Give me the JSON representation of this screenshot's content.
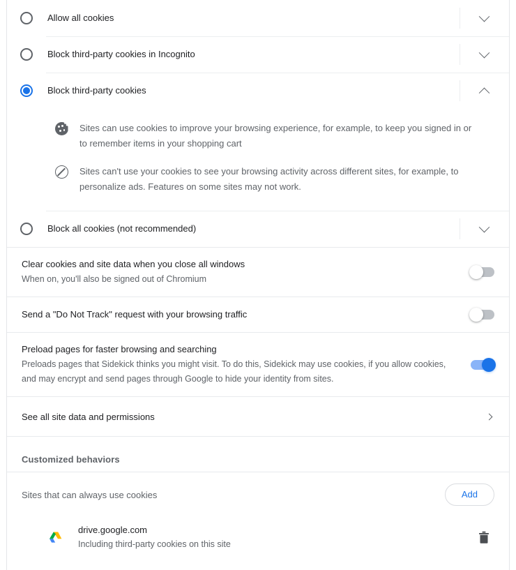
{
  "cookie_options": [
    {
      "label": "Allow all cookies",
      "selected": false,
      "expand_icon": "chevron-down-icon"
    },
    {
      "label": "Block third-party cookies in Incognito",
      "selected": false,
      "expand_icon": "chevron-down-icon"
    },
    {
      "label": "Block third-party cookies",
      "selected": true,
      "expand_icon": "chevron-up-icon"
    },
    {
      "label": "Block all cookies (not recommended)",
      "selected": false,
      "expand_icon": "chevron-down-icon"
    }
  ],
  "expanded_details": [
    {
      "icon": "cookie-icon",
      "text": "Sites can use cookies to improve your browsing experience, for example, to keep you signed in or to remember items in your shopping cart"
    },
    {
      "icon": "block-icon",
      "text": "Sites can't use your cookies to see your browsing activity across different sites, for example, to personalize ads. Features on some sites may not work."
    }
  ],
  "toggles": [
    {
      "title": "Clear cookies and site data when you close all windows",
      "subtitle": "When on, you'll also be signed out of Chromium",
      "state": "off"
    },
    {
      "title": "Send a \"Do Not Track\" request with your browsing traffic",
      "subtitle": "",
      "state": "off"
    },
    {
      "title": "Preload pages for faster browsing and searching",
      "subtitle": "Preloads pages that Sidekick thinks you might visit. To do this, Sidekick may use cookies, if you allow cookies, and may encrypt and send pages through Google to hide your identity from sites.",
      "state": "on"
    }
  ],
  "nav": {
    "see_all_label": "See all site data and permissions",
    "arrow_icon": "arrow-right-icon"
  },
  "customized": {
    "heading": "Customized behaviors",
    "always_allow_label": "Sites that can always use cookies",
    "add_label": "Add",
    "sites": [
      {
        "icon": "google-drive-icon",
        "name": "drive.google.com",
        "detail": "Including third-party cookies on this site",
        "delete_icon": "trash-icon"
      }
    ]
  },
  "colors": {
    "accent": "#1a73e8",
    "toggle_on_track": "#8ab4f8",
    "toggle_off_track": "#bdc1c6",
    "text_primary": "#202124",
    "text_secondary": "#5f6368",
    "divider": "#e8eaed"
  }
}
